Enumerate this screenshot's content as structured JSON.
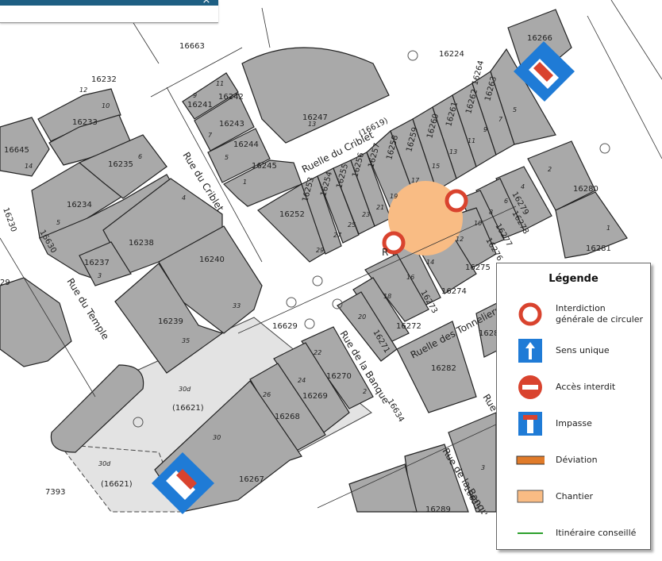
{
  "window": {
    "close_label": "×"
  },
  "legend": {
    "title": "Légende",
    "items": [
      {
        "id": "interdiction",
        "label": "Interdiction générale de circuler",
        "color": "#d9432e"
      },
      {
        "id": "sens-unique",
        "label": "Sens unique",
        "color": "#1f7bd6"
      },
      {
        "id": "acces-interdit",
        "label": "Accès interdit",
        "color": "#d9432e"
      },
      {
        "id": "impasse",
        "label": "Impasse",
        "color": "#1f7bd6"
      },
      {
        "id": "deviation",
        "label": "Déviation",
        "color": "#e07b2a"
      },
      {
        "id": "chantier",
        "label": "Chantier",
        "color": "#f9bc84"
      },
      {
        "id": "itineraire",
        "label": "Itinéraire conseillé",
        "color": "#2ca02c"
      }
    ]
  },
  "streets": {
    "cribiet": "Rue du Criblet",
    "temple": "Rue du Temple",
    "banque": "Rue de la Banque",
    "banque2": "Rue de la Banque",
    "ruelle_criblet": "Ruelle du Criblet",
    "ruelle_tonneliers": "Ruelle des Tonneliers",
    "partial_rue": "Rue",
    "partial_r": "R"
  },
  "parcels": {
    "p16663": "16663",
    "p16224": "16224",
    "p16266": "16266",
    "p16232": "16232",
    "p16233": "16233",
    "p16241": "16241",
    "p16242": "16242",
    "p16243": "16243",
    "p16244": "16244",
    "p16245": "16245",
    "p16247": "16247",
    "p16645": "16645",
    "p16235": "16235",
    "p16234": "16234",
    "p16230": "16230",
    "p16630": "16630",
    "p16238": "16238",
    "p16237": "16237",
    "p16240": "16240",
    "p16239": "16239",
    "p16252": "16252",
    "p16253": "16253",
    "p16254": "16254",
    "p16255": "16255",
    "p16256": "16256",
    "p16257": "16257",
    "p16258": "16258",
    "p16259": "16259",
    "p16260": "16260",
    "p16261": "16261",
    "p16262": "16262",
    "p16263": "16263",
    "p16264": "16264",
    "p16280": "16280",
    "p16279": "16279",
    "p16278": "16278",
    "p16277": "16277",
    "p16276": "16276",
    "p16281": "16281",
    "p16275": "16275",
    "p16274": "16274",
    "p16273": "16273",
    "p16272": "16272",
    "p16271": "16271",
    "p16282": "16282",
    "p16629": "16629",
    "p16270": "16270",
    "p16269": "16269",
    "p16268": "16268",
    "p16267": "16267",
    "p16621a": "(16621)",
    "p16621b": "(16621)",
    "p7393": "7393",
    "p16289": "16289",
    "p16634": "16634",
    "p16635": "16635",
    "p1628": "1628",
    "p29": "29",
    "p16619": "(16619)",
    "p16": "16"
  },
  "numbers": {
    "n9": "9",
    "n11": "11",
    "n7": "7",
    "n5": "5",
    "n3": "3",
    "n1": "1",
    "n13": "13",
    "n12": "12",
    "n10": "10",
    "n14": "14",
    "n6": "6",
    "n4": "4",
    "n2": "2",
    "n33": "33",
    "n35": "35",
    "n27": "27",
    "n25": "25",
    "n23": "23",
    "n21": "21",
    "n19": "19",
    "n17": "17",
    "n15": "15",
    "n13b": "13",
    "n11b": "11",
    "n9b": "9",
    "n7b": "7",
    "n5b": "5",
    "n29": "29",
    "n18": "18",
    "n16": "16",
    "n14b": "14",
    "n20": "20",
    "n22": "22",
    "n24": "24",
    "n26": "26",
    "n30d": "30d",
    "n30": "30",
    "n30d2": "30d",
    "n6b": "6",
    "n4b": "4",
    "n8": "8",
    "n10b": "10",
    "n12b": "12",
    "n2b": "2",
    "n3b": "3",
    "n1b": "1"
  }
}
